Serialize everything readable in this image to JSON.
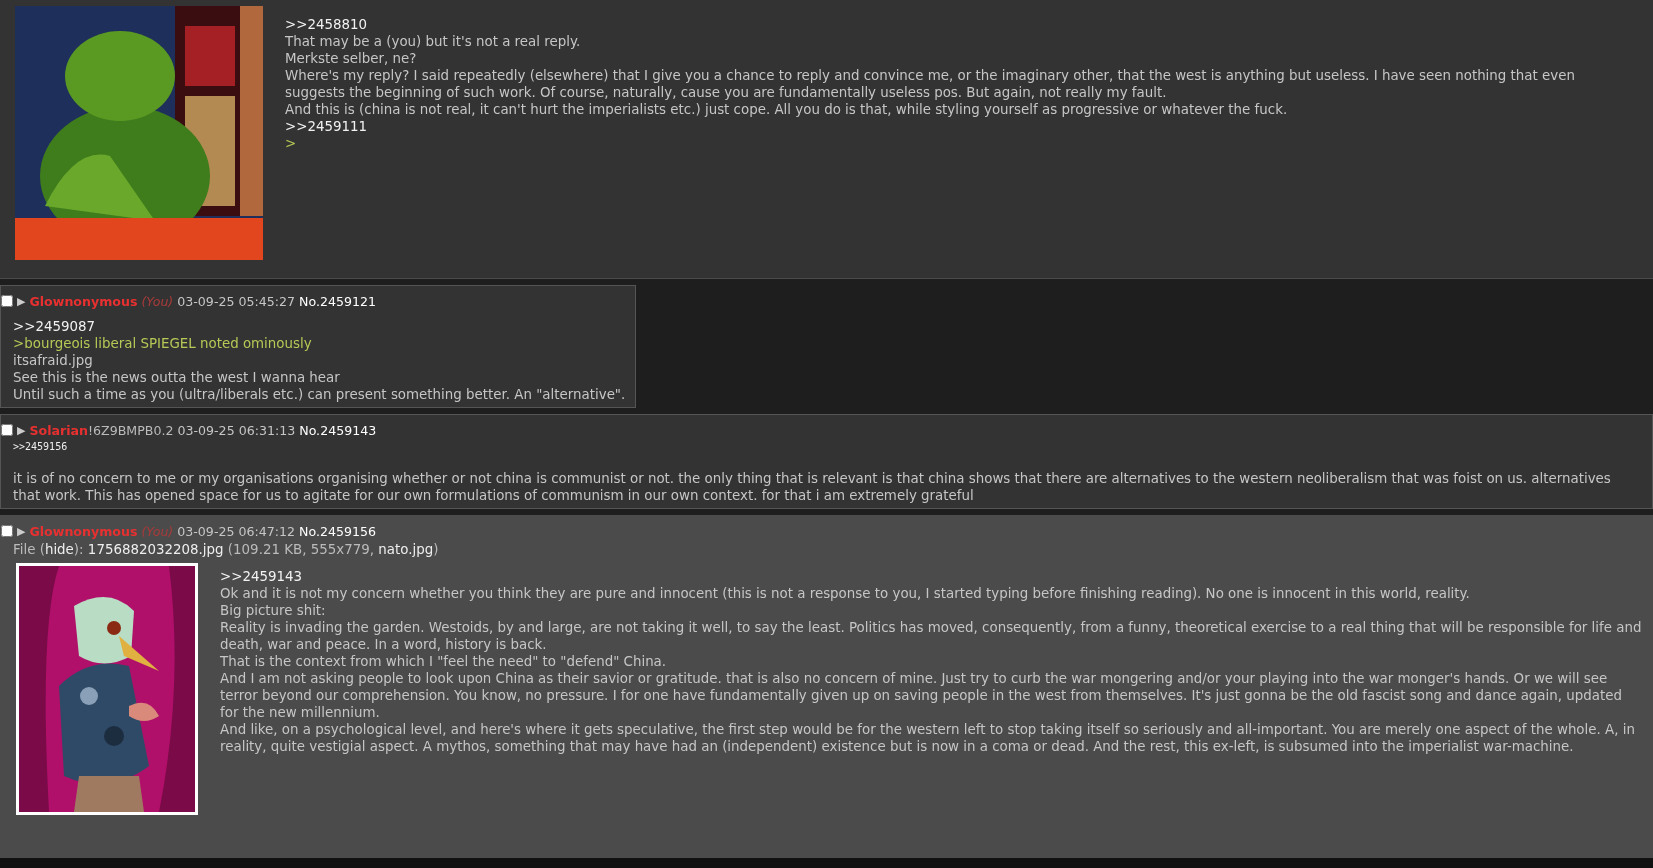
{
  "posts": [
    {
      "kind": "op",
      "highlighted": false,
      "lines": [
        {
          "kind": "quotelink",
          "text": ">>2458810"
        },
        {
          "kind": "text",
          "text": "That may be a (you) but it's not a real reply."
        },
        {
          "kind": "text",
          "text": "Merkste selber, ne?"
        },
        {
          "kind": "text",
          "text": "Where's my reply? I said repeatedly (elsewhere) that I give you a chance to reply and convince me, or the imaginary other, that the west is anything but useless. I have seen nothing that even suggests the beginning of such work. Of course, naturally, cause you are fundamentally useless pos. But again, not really my fault."
        },
        {
          "kind": "text",
          "text": "And this is (china is not real, it can't hurt the imperialists etc.) just cope. All you do is that, while styling yourself as progressive or whatever the fuck."
        },
        {
          "kind": "quotelink",
          "text": ">>2459111"
        },
        {
          "kind": "greentext",
          "text": ">"
        }
      ]
    },
    {
      "kind": "reply",
      "highlighted": false,
      "checked": false,
      "menu_glyph": "▶",
      "name": "Glownonymous",
      "you": "(You)",
      "date": "03-09-25 05:45:27",
      "number": "No.2459121",
      "lines": [
        {
          "kind": "quotelink",
          "text": ">>2459087"
        },
        {
          "kind": "greentext",
          "text": ">bourgeois liberal SPIEGEL noted ominously"
        },
        {
          "kind": "text",
          "text": "itsafraid.jpg"
        },
        {
          "kind": "text",
          "text": "See this is the news outta the west I wanna hear"
        },
        {
          "kind": "text",
          "text": "Until such a time as you (ultra/liberals etc.) can present something better. An \"alternative\"."
        }
      ]
    },
    {
      "kind": "reply",
      "highlighted": false,
      "checked": false,
      "menu_glyph": "▶",
      "name": "Solarian",
      "tripcode": "!6Z9BMPB0.2",
      "date": "03-09-25 06:31:13",
      "number": "No.2459143",
      "backlinks": [
        ">>2459156"
      ],
      "lines": [
        {
          "kind": "text",
          "text": "it is of no concern to me or my organisations organising whether or not china is communist or not. the only thing that is relevant is that china shows that there are alternatives to the western neoliberalism that was foist on us. alternatives that work. This has opened space for us to agitate for our own formulations of communism in our own context. for that i am extremely grateful"
        }
      ]
    },
    {
      "kind": "reply",
      "highlighted": true,
      "checked": false,
      "menu_glyph": "▶",
      "name": "Glownonymous",
      "you": "(You)",
      "date": "03-09-25 06:47:12",
      "number": "No.2459156",
      "file": {
        "label": "File (",
        "hide": "hide",
        "colon": "):",
        "filename": "1756882032208.jpg",
        "meta": "(109.21 KB, 555x779,",
        "original": "nato.jpg",
        "close": ")"
      },
      "lines": [
        {
          "kind": "quotelink",
          "text": ">>2459143"
        },
        {
          "kind": "text",
          "text": "Ok and it is not my concern whether you think they are pure and innocent (this is not a response to you, I started typing before finishing reading). No one is innocent in this world, reality."
        },
        {
          "kind": "text",
          "text": "Big picture shit:"
        },
        {
          "kind": "text",
          "text": "Reality is invading the garden. Westoids, by and large, are not taking it well, to say the least. Politics has moved, consequently, from a funny, theoretical exercise to a real thing that will be responsible for life and death, war and peace. In a word, history is back."
        },
        {
          "kind": "text",
          "text": "That is the context from which I \"feel the need\" to \"defend\" China."
        },
        {
          "kind": "text",
          "text": "And I am not asking people to look upon China as their savior or gratitude. that is also no concern of mine. Just try to curb the war mongering and/or your playing into the war monger's hands. Or we will see terror beyond our comprehension. You know, no pressure. I for one have fundamentally given up on saving people in the west from themselves. It's just gonna be the old fascist song and dance again, updated for the new millennium."
        },
        {
          "kind": "text",
          "text": "And like, on a psychological level, and here's where it gets speculative, the first step would be for the western left to stop taking itself so seriously and all-important. You are merely one aspect of the whole. A, in reality, quite vestigial aspect. A mythos, something that may have had an (independent) existence but is now in a coma or dead. And the rest, this ex-left, is subsumed into the imperialist war-machine."
        }
      ]
    }
  ]
}
